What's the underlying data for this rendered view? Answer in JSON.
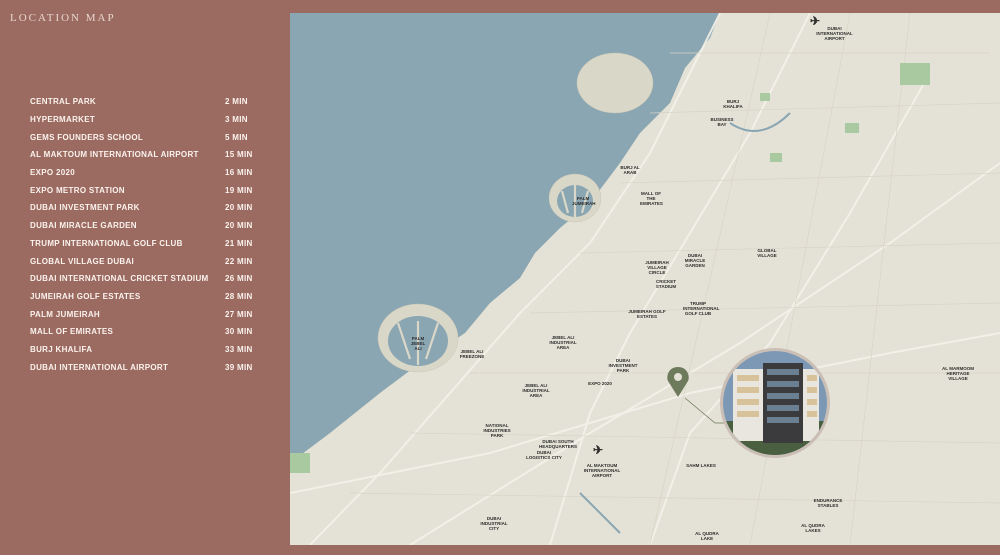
{
  "title": "LOCATION MAP",
  "locations": [
    {
      "name": "CENTRAL PARK",
      "time": "2 MIN"
    },
    {
      "name": "HYPERMARKET",
      "time": "3 MIN"
    },
    {
      "name": "GEMS FOUNDERS SCHOOL",
      "time": "5 MIN"
    },
    {
      "name": "AL MAKTOUM INTERNATIONAL AIRPORT",
      "time": "15 MIN"
    },
    {
      "name": "EXPO 2020",
      "time": "16 MIN"
    },
    {
      "name": "EXPO METRO STATION",
      "time": "19 MIN"
    },
    {
      "name": "DUBAI INVESTMENT PARK",
      "time": "20 MIN"
    },
    {
      "name": "DUBAI MIRACLE GARDEN",
      "time": "20 MIN"
    },
    {
      "name": "TRUMP INTERNATIONAL GOLF CLUB",
      "time": "21 MIN"
    },
    {
      "name": "GLOBAL VILLAGE DUBAI",
      "time": "22 MIN"
    },
    {
      "name": "DUBAI INTERNATIONAL CRICKET STADIUM",
      "time": "26 MIN"
    },
    {
      "name": "JUMEIRAH GOLF ESTATES",
      "time": "28 MIN"
    },
    {
      "name": "PALM JUMEIRAH",
      "time": "27 MIN"
    },
    {
      "name": "MALL OF EMIRATES",
      "time": "30 MIN"
    },
    {
      "name": "BURJ KHALIFA",
      "time": "33 MIN"
    },
    {
      "name": "DUBAI INTERNATIONAL AIRPORT",
      "time": "39 MIN"
    }
  ],
  "map_labels": {
    "dxb": "DUBAI INTERNATIONAL AIRPORT",
    "burj_khalifa": "BURJ KHALIFA",
    "business_bay": "BUSINESS BAY",
    "burj_al_arab": "BURJ AL ARAB",
    "palm_jumeirah": "PALM JUMEIRAH",
    "mall_of_emirates": "MALL OF THE EMIRATES",
    "miracle_garden": "DUBAI MIRACLE GARDEN",
    "global_village": "GLOBAL VILLAGE",
    "jvc": "JUMEIRAH VILLAGE CIRCLE",
    "cricket": "CRICKET STADIUM",
    "trump": "TRUMP INTERNATIONAL GOLF CLUB",
    "jge": "JUMEIRAH GOLF ESTATES",
    "palm_jebel_ali": "PALM JEBEL ALI",
    "jafz": "JEBEL ALI FREEZONE",
    "jai_1": "JEBEL ALI INDUSTRIAL AREA",
    "jai_2": "JEBEL ALI INDUSTRIAL AREA",
    "dip": "DUBAI INVESTMENT PARK",
    "expo": "EXPO 2020",
    "dwc": "AL MAKTOUM INTERNATIONAL AIRPORT",
    "hq": "DUBAI SOUTH HEADQUARTERS",
    "logistics": "DUBAI LOGISTICS CITY",
    "national_ind": "NATIONAL INDUSTRIES PARK",
    "al_marmoom": "AL MARMOOM HERITAGE VILLAGE",
    "sahm": "SAHM LAKES",
    "al_qudra_lake": "AL QUDRA LAKE",
    "al_qudra_lakes": "AL QUDRA LAKES",
    "endurance": "ENDURANCE STABLES",
    "dubai_ind_city": "DUBAI INDUSTRIAL CITY"
  },
  "colors": {
    "background": "#9b6a60",
    "sea": "#8aa6b2",
    "land": "#e4e2d6",
    "parks": "#a9c9a0",
    "pin": "#6e7a5c"
  }
}
